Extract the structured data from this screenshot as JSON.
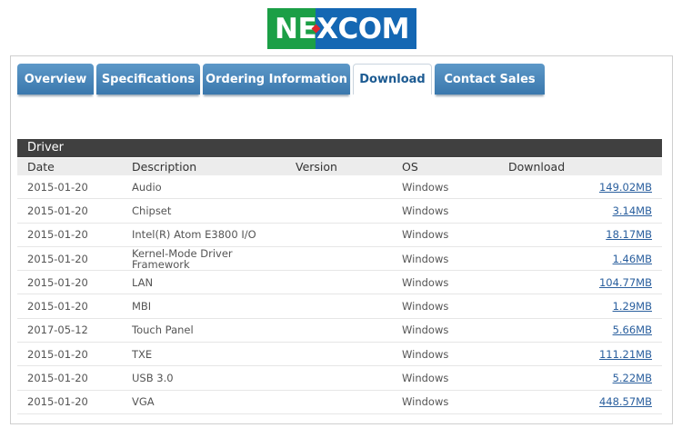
{
  "brand": {
    "logo_text_1": "NE",
    "logo_text_2": "X",
    "logo_text_3": "COM",
    "colors": {
      "green": "#1b9f46",
      "blue": "#1467b3",
      "red": "#e0262b"
    }
  },
  "tabs": [
    {
      "label": "Overview",
      "active": false
    },
    {
      "label": "Specifications",
      "active": false
    },
    {
      "label": "Ordering Information",
      "active": false
    },
    {
      "label": "Download",
      "active": true
    },
    {
      "label": "Contact Sales",
      "active": false
    }
  ],
  "section": {
    "title": "Driver"
  },
  "table": {
    "headers": {
      "date": "Date",
      "description": "Description",
      "version": "Version",
      "os": "OS",
      "download": "Download"
    },
    "rows": [
      {
        "date": "2015-01-20",
        "description": "Audio",
        "version": "",
        "os": "Windows",
        "download": "149.02MB"
      },
      {
        "date": "2015-01-20",
        "description": "Chipset",
        "version": "",
        "os": "Windows",
        "download": "3.14MB"
      },
      {
        "date": "2015-01-20",
        "description": "Intel(R) Atom E3800 I/O",
        "version": "",
        "os": "Windows",
        "download": "18.17MB"
      },
      {
        "date": "2015-01-20",
        "description": "Kernel-Mode Driver Framework",
        "version": "",
        "os": "Windows",
        "download": "1.46MB"
      },
      {
        "date": "2015-01-20",
        "description": "LAN",
        "version": "",
        "os": "Windows",
        "download": "104.77MB"
      },
      {
        "date": "2015-01-20",
        "description": "MBI",
        "version": "",
        "os": "Windows",
        "download": "1.29MB"
      },
      {
        "date": "2017-05-12",
        "description": "Touch Panel",
        "version": "",
        "os": "Windows",
        "download": "5.66MB"
      },
      {
        "date": "2015-01-20",
        "description": "TXE",
        "version": "",
        "os": "Windows",
        "download": "111.21MB"
      },
      {
        "date": "2015-01-20",
        "description": "USB 3.0",
        "version": "",
        "os": "Windows",
        "download": "5.22MB"
      },
      {
        "date": "2015-01-20",
        "description": "VGA",
        "version": "",
        "os": "Windows",
        "download": "448.57MB"
      }
    ]
  }
}
